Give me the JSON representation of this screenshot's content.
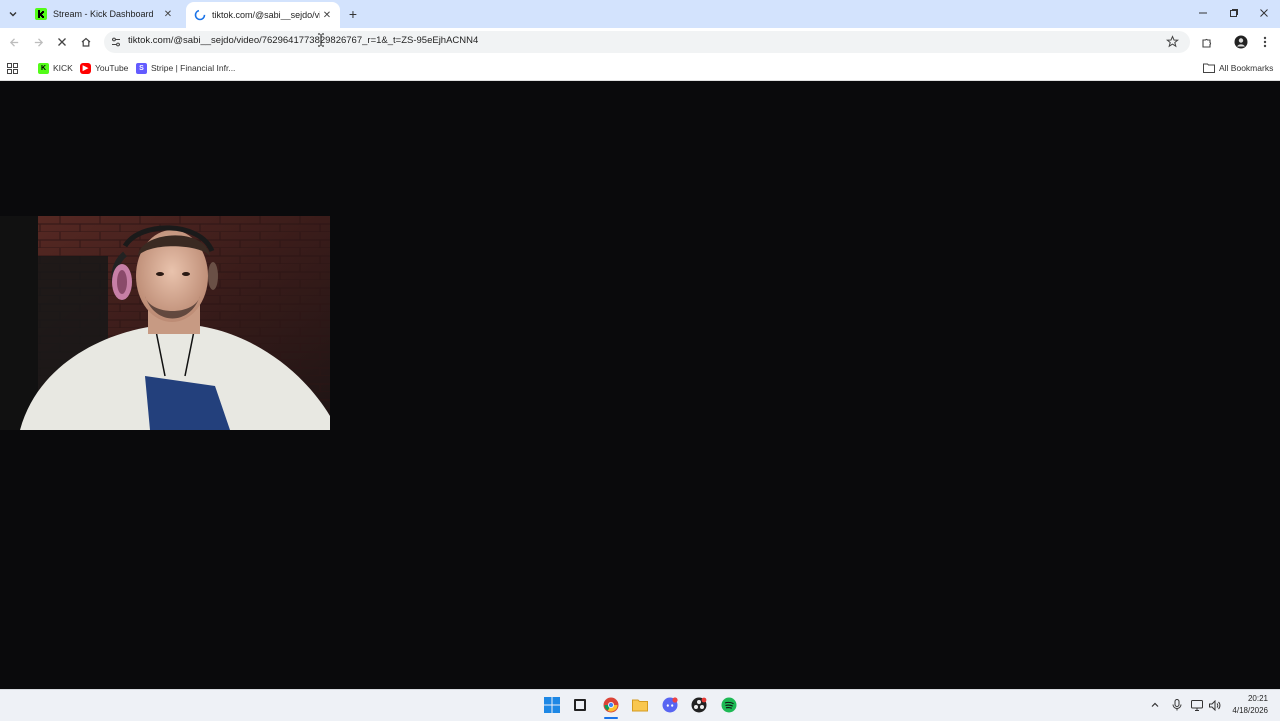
{
  "browser": {
    "tabs": [
      {
        "title": "Stream - Kick Dashboard",
        "icon": "kick-logo-icon",
        "active": false
      },
      {
        "title": "tiktok.com/@sabi__sejdo/video",
        "icon": "loading-icon",
        "active": true
      }
    ],
    "url": "tiktok.com/@sabi__sejdo/video/7629641773829826767_r=1&_t=ZS-95eEjhACNN4",
    "bookmarks": [
      {
        "label": "KICK",
        "icon": "kick-icon",
        "color": "#53fc18"
      },
      {
        "label": "YouTube",
        "icon": "youtube-icon",
        "color": "#ff0000"
      },
      {
        "label": "Stripe | Financial Infr...",
        "icon": "stripe-icon",
        "color": "#635bff"
      }
    ],
    "all_bookmarks_label": "All Bookmarks"
  },
  "taskbar": {
    "time": "20:21",
    "date": "4/18/2026"
  },
  "colors": {
    "tabstrip": "#d3e3fd",
    "content_bg": "#0a0a0c",
    "kick_green": "#53fc18"
  }
}
